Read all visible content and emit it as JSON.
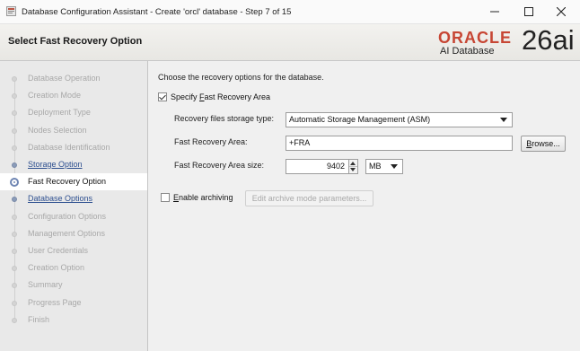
{
  "window": {
    "title": "Database Configuration Assistant - Create 'orcl' database - Step 7 of 15",
    "icons": {
      "app": "app-icon",
      "minimize": "minimize-icon",
      "maximize": "maximize-icon",
      "close": "close-icon"
    }
  },
  "header": {
    "heading": "Select Fast Recovery Option",
    "logo": {
      "brand": "ORACLE",
      "product": "AI Database",
      "version": "26ai"
    }
  },
  "sidebar": {
    "steps": [
      {
        "label": "Database Operation",
        "state": "disabled"
      },
      {
        "label": "Creation Mode",
        "state": "disabled"
      },
      {
        "label": "Deployment Type",
        "state": "disabled"
      },
      {
        "label": "Nodes Selection",
        "state": "disabled"
      },
      {
        "label": "Database Identification",
        "state": "disabled"
      },
      {
        "label": "Storage Option",
        "state": "done"
      },
      {
        "label": "Fast Recovery Option",
        "state": "current"
      },
      {
        "label": "Database Options",
        "state": "next"
      },
      {
        "label": "Configuration Options",
        "state": "disabled"
      },
      {
        "label": "Management Options",
        "state": "disabled"
      },
      {
        "label": "User Credentials",
        "state": "disabled"
      },
      {
        "label": "Creation Option",
        "state": "disabled"
      },
      {
        "label": "Summary",
        "state": "disabled"
      },
      {
        "label": "Progress Page",
        "state": "disabled"
      },
      {
        "label": "Finish",
        "state": "disabled"
      }
    ]
  },
  "main": {
    "instruction": "Choose the recovery options for the database.",
    "specify_fra": {
      "pre": "Specify ",
      "mnemonic": "F",
      "post": "ast Recovery Area",
      "checked": true
    },
    "storage_type": {
      "label": "Recovery files storage type:",
      "value": "Automatic Storage Management (ASM)"
    },
    "fra": {
      "label": "Fast Recovery Area:",
      "value": "+FRA",
      "browse": {
        "mnemonic": "B",
        "post": "rowse..."
      }
    },
    "fra_size": {
      "label": "Fast Recovery Area size:",
      "value": "9402",
      "unit": "MB"
    },
    "archiving": {
      "mnemonic": "E",
      "post": "nable archiving",
      "checked": false
    },
    "archive_params_button": "Edit archive mode parameters..."
  }
}
